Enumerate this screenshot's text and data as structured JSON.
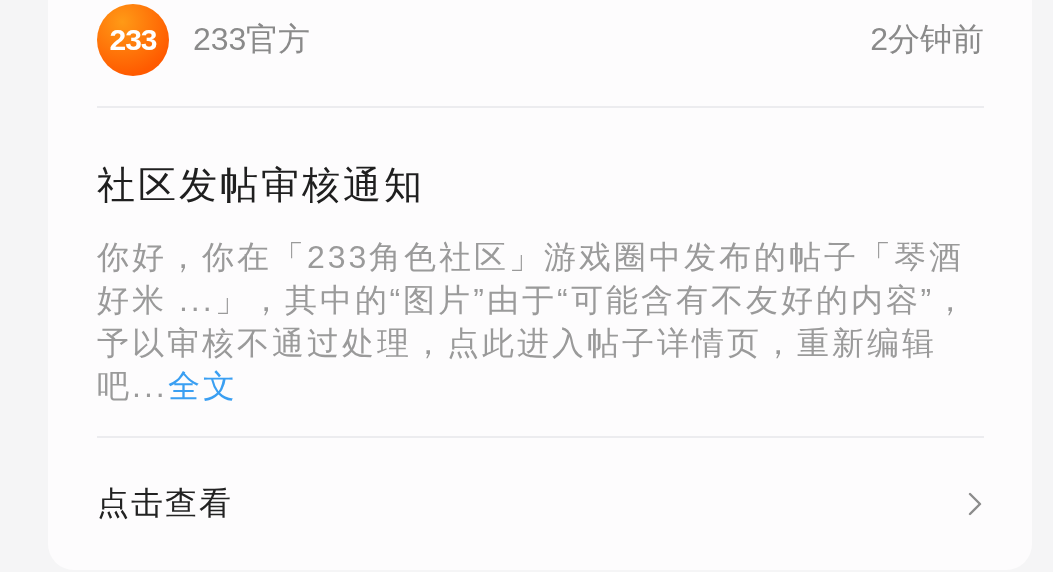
{
  "sender": {
    "logo_text": "233",
    "name": "233官方",
    "time": "2分钟前"
  },
  "notice": {
    "title": "社区发帖审核通知",
    "body": "你好，你在「233角色社区」游戏圈中发布的帖子「琴酒好米 ...」，其中的“图片”由于“可能含有不友好的内容”，予以审核不通过处理，点此进入帖子详情页，重新编辑吧...",
    "more_link": "全文"
  },
  "action": {
    "label": "点击查看"
  }
}
